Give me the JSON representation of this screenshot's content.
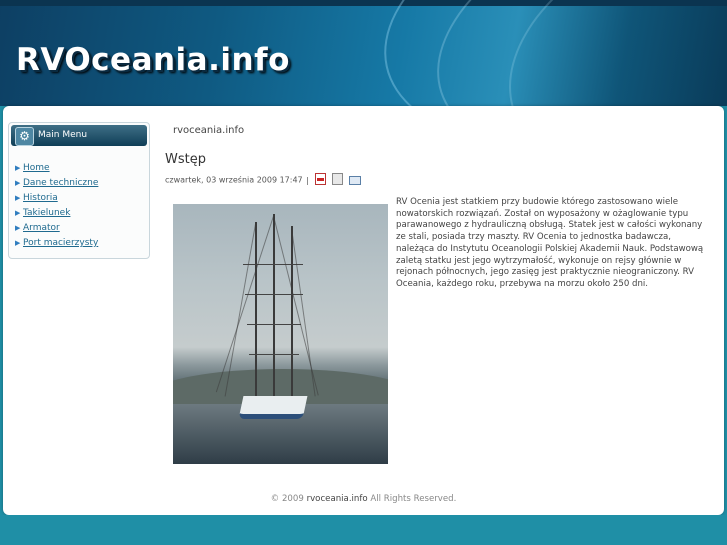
{
  "site": {
    "logo": "RVOceania.info"
  },
  "sidebar": {
    "title": "Main Menu",
    "items": [
      {
        "label": "Home"
      },
      {
        "label": "Dane techniczne"
      },
      {
        "label": "Historia"
      },
      {
        "label": "Takielunek"
      },
      {
        "label": "Armator"
      },
      {
        "label": "Port macierzysty"
      }
    ]
  },
  "main": {
    "breadcrumb": "rvoceania.info",
    "title": "Wstęp",
    "date": "czwartek, 03 września 2009 17:47",
    "separator": "|",
    "icons": [
      "pdf-icon",
      "print-icon",
      "email-icon"
    ],
    "body": "RV Ocenia jest statkiem przy budowie którego zastosowano wiele nowatorskich rozwiązań. Został on wyposażony w ożaglowanie typu parawanowego z hydrauliczną obsługą. Statek jest w całości wykonany ze stali, posiada trzy maszty. RV Ocenia to jednostka badawcza, należąca do Instytutu Oceanologii Polskiej Akademii Nauk. Podstawową zaletą statku jest jego wytrzymałość, wykonuje on rejsy głównie w rejonach północnych, jego zasięg jest praktycznie nieograniczony. RV Oceania, każdego roku, przebywa na morzu około 250 dni."
  },
  "footer": {
    "copyright": "© 2009",
    "site": "rvoceania.info",
    "rights": "All Rights Reserved."
  },
  "colors": {
    "header_dark": "#0d3f63",
    "header_accent": "#2a8fb8",
    "link": "#1f6a8f",
    "background": "#1f8fa6"
  }
}
